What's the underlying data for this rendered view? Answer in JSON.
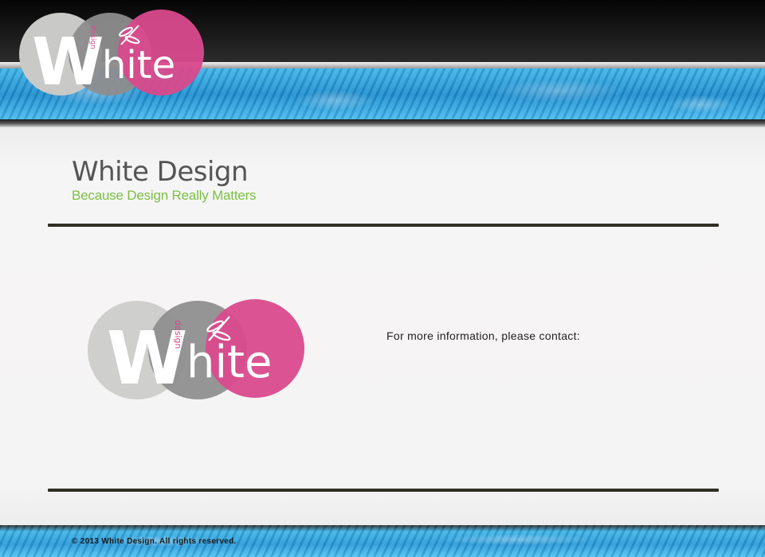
{
  "header": {
    "logo": {
      "word": "hite",
      "initial": "W",
      "small": "design",
      "icon": "dragonfly-icon"
    }
  },
  "brand": {
    "title": "White Design",
    "tagline": "Because Design Really Matters"
  },
  "main": {
    "logo": {
      "word": "hite",
      "initial": "W",
      "small": "design",
      "icon": "dragonfly-icon"
    },
    "contact_text": "For more information, please contact:"
  },
  "footer": {
    "copyright": "© 2013 White Design. All rights reserved."
  },
  "colors": {
    "pink": "#d94a8c",
    "gray_dark": "#8f8f8f",
    "gray_light": "#cfcfcf",
    "tagline_green": "#7ac143",
    "band_blue": "#2a9ad8"
  }
}
